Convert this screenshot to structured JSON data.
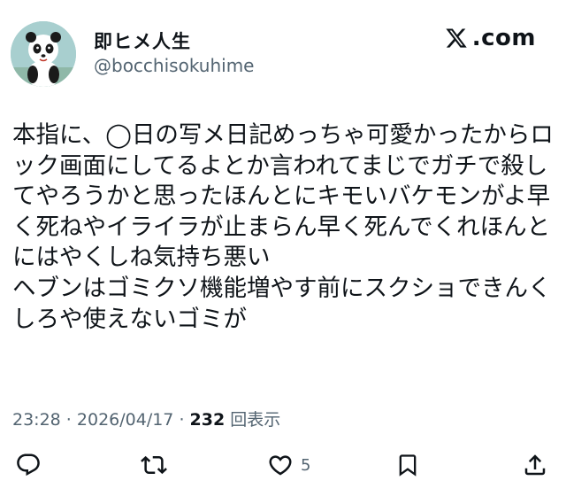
{
  "author": {
    "display_name": "即ヒメ人生",
    "handle": "@bocchisokuhime"
  },
  "brand": {
    "name": ".com",
    "logo_icon": "x-logo-icon"
  },
  "tweet": {
    "lines": [
      "本指に、◯日の写メ日記めっちゃ可愛かったからロ",
      "ック画面にしてるよとか言われてまじでガチで殺し",
      "てやろうかと思ったほんとにキモいバケモンがよ早",
      "く死ねやイライラが止まらん早く死んでくれほんと",
      "にはやくしね気持ち悪い",
      "ヘブンはゴミクソ機能増やす前にスクショできんく",
      "しろや使えないゴミが"
    ]
  },
  "meta": {
    "time": "23:28",
    "sep1": " · ",
    "date": "2026/04/17",
    "sep2": " · ",
    "views": "232",
    "views_label": " 回表示"
  },
  "actions": {
    "reply_icon": "reply-icon",
    "retweet_icon": "retweet-icon",
    "like_icon": "heart-icon",
    "like_count": "5",
    "bookmark_icon": "bookmark-icon",
    "share_icon": "share-icon"
  },
  "colors": {
    "text": "#0f1419",
    "secondary": "#536471",
    "background": "#ffffff",
    "avatar_bg": "#a8cfcf"
  }
}
